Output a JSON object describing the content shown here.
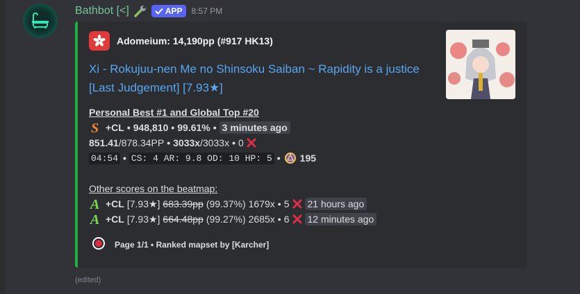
{
  "message": {
    "username": "Bathbot [<]",
    "app_badge": "APP",
    "timestamp": "8:57 PM",
    "edited": "(edited)"
  },
  "embed": {
    "author": "Adomeium: 14,190pp (#917 HK13)",
    "title": "Xi - Rokujuu-nen Me no Shinsoku Saiban ~ Rapidity is a justice [Last Judgement] [7.93★]",
    "personal_best": "Personal Best #1 and Global Top #20",
    "score_line": {
      "mods": "+CL",
      "sep1": "•",
      "score": "948,810",
      "sep2": "•",
      "accuracy": "99.61%",
      "sep3": "•",
      "time_ago": "3 minutes ago"
    },
    "pp_line": {
      "pp": "851.41",
      "pp_max": "/878.34PP",
      "sep1": "•",
      "combo": "3033x",
      "combo_max": "/3033x",
      "sep2": "•",
      "misses": "0"
    },
    "map_line": {
      "length": "04:54",
      "sep1": "•",
      "stats": "CS: 4 AR: 9.8 OD: 10 HP: 5",
      "sep2": "•",
      "bpm": "195"
    },
    "other_scores_header": "Other scores on the beatmap:",
    "other_scores": [
      {
        "mods": "+CL",
        "stars": "[7.93★]",
        "pp": "683.39pp",
        "acc": "(99.37%)",
        "combo": "1679x",
        "sep": "•",
        "misses": "5",
        "time_ago": "21 hours ago"
      },
      {
        "mods": "+CL",
        "stars": "[7.93★]",
        "pp": "664.48pp",
        "acc": "(99.27%)",
        "combo": "2685x",
        "sep": "•",
        "misses": "6",
        "time_ago": "12 minutes ago"
      }
    ],
    "footer": "Page 1/1 • Ranked mapset by [Karcher]"
  },
  "colors": {
    "accent_bar": "#1fae43",
    "link": "#58a6f0",
    "username": "#79c497",
    "app_badge": "#5865f2",
    "rank_s": "#f08a30",
    "rank_a": "#7ed957",
    "miss_x": "#dd2e44"
  },
  "icons": [
    "bathtub-icon",
    "wrench-icon",
    "checkmark-icon",
    "hk-flag-icon",
    "rank-s-icon",
    "rank-a-icon",
    "miss-x-icon",
    "bpm-icon",
    "osu-icon"
  ]
}
